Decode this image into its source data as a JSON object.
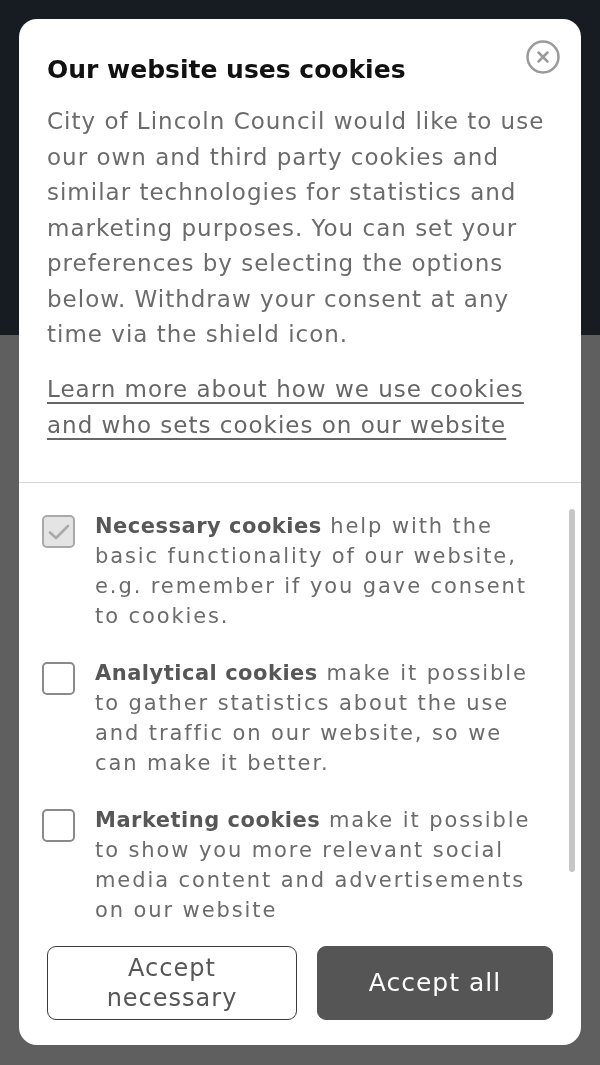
{
  "dialog": {
    "title": "Our website uses cookies",
    "description": "City of Lincoln Council would like to use our own and third party cookies and similar technologies for statistics and marketing purposes. You can set your preferences by selecting the options below. Withdraw your consent at any time via the shield icon.",
    "link": "Learn more about how we use cookies and who sets cookies on our website"
  },
  "options": [
    {
      "text": "**Necessary cookies** help with the basic functionality of our website, e.g. remember if you gave consent to cookies.",
      "checked": true,
      "disabled": true
    },
    {
      "text": "**Analytical cookies** make it possible to gather statistics about the use and traffic on our website, so we can make it better.",
      "checked": false,
      "disabled": false
    },
    {
      "text": "**Marketing cookies** make it possible to show you more relevant social media content and advertisements on our website",
      "checked": false,
      "disabled": false
    }
  ],
  "buttons": [
    {
      "label": "Accept necessary",
      "kind": "outline"
    },
    {
      "label": "Accept all",
      "kind": "filled"
    }
  ]
}
